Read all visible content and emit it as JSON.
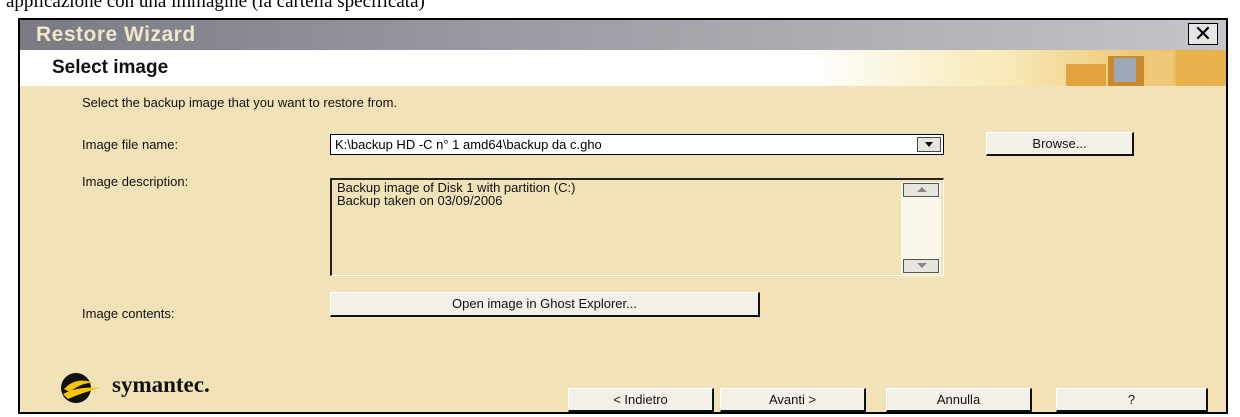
{
  "document": {
    "caption": "applicazione con una immagine (la cartella specificata)"
  },
  "window": {
    "title": "Restore Wizard",
    "close_glyph": "✕"
  },
  "header": {
    "page_title": "Select image"
  },
  "main": {
    "instruction": "Select the backup image that you want to restore from.",
    "image_file": {
      "label": "Image file name:",
      "value": "K:\\backup HD -C n° 1 amd64\\backup da c.gho",
      "browse_label": "Browse..."
    },
    "description": {
      "label": "Image description:",
      "lines": [
        "Backup image of Disk 1 with partition (C:)",
        "Backup taken on 03/09/2006"
      ]
    },
    "contents": {
      "label": "Image contents:",
      "button_label": "Open image in Ghost Explorer..."
    }
  },
  "footer": {
    "brand": "symantec.",
    "back_label": "< Indietro",
    "next_label": "Avanti >",
    "cancel_label": "Annulla",
    "help_label": "?"
  },
  "colors": {
    "window_bg": "#f1e3b7",
    "brand_yellow": "#f7c600",
    "header_accent": "#e9b24c"
  }
}
